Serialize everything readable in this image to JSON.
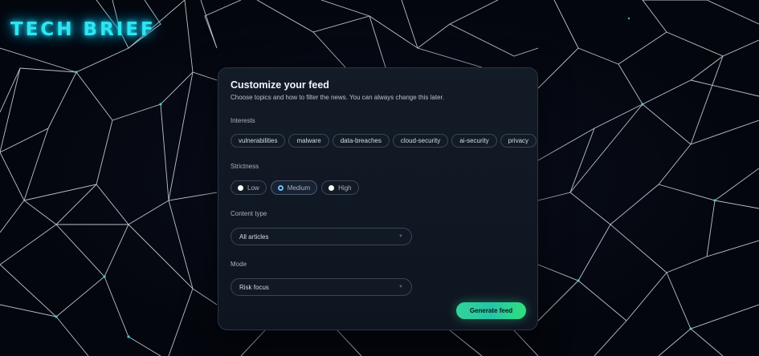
{
  "brand": {
    "logo_text": "TECH BRIEF",
    "accent": "#2ee6f2"
  },
  "panel": {
    "title": "Customize your feed",
    "subtitle": "Choose topics and how to filter the news. You can always change this later."
  },
  "interests": {
    "label": "Interests",
    "topics": [
      "vulnerabilities",
      "malware",
      "data-breaches",
      "cloud-security",
      "ai-security",
      "privacy"
    ]
  },
  "strictness": {
    "label": "Strictness",
    "options": [
      "Low",
      "Medium",
      "High"
    ],
    "selected": "Medium"
  },
  "content_type": {
    "label": "Content type",
    "value": "All articles"
  },
  "mode": {
    "label": "Mode",
    "value": "Risk focus"
  },
  "actions": {
    "generate_label": "Generate feed",
    "generate_color": "#34d39a"
  }
}
